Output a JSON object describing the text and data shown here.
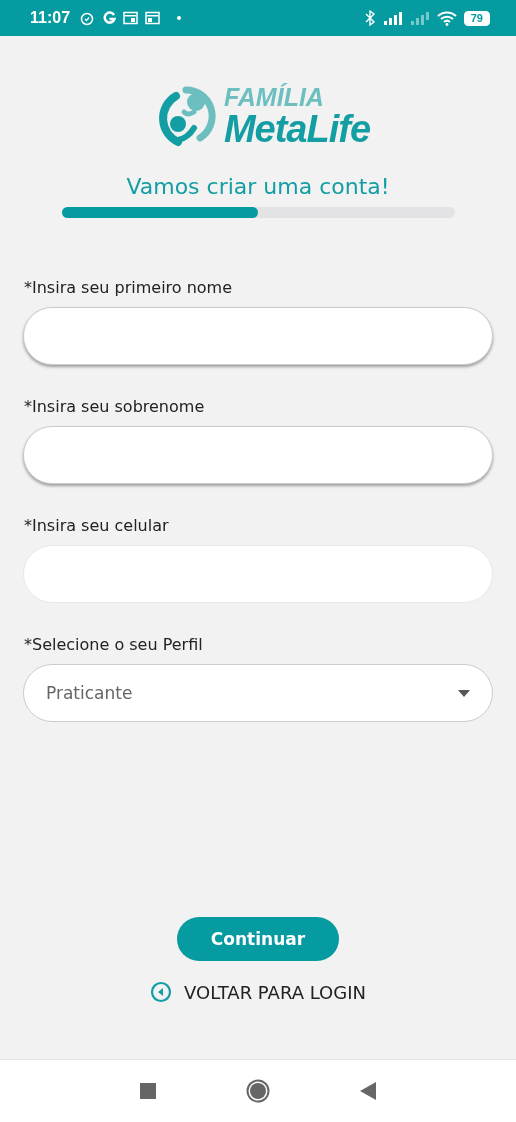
{
  "status_bar": {
    "time": "11:07",
    "battery": "79"
  },
  "logo": {
    "top": "FAMÍLIA",
    "bottom": "MetaLife"
  },
  "title": "Vamos criar uma conta!",
  "progress": {
    "level": 0.5
  },
  "fields": [
    {
      "kind": "text",
      "label": "*Insira seu primeiro nome",
      "raised": true
    },
    {
      "kind": "text",
      "label": "*Insira seu sobrenome",
      "raised": true
    },
    {
      "kind": "text",
      "label": "*Insira seu celular",
      "raised": false
    },
    {
      "kind": "select",
      "label": "*Selecione o seu Perfil",
      "value": "Praticante",
      "raised": false
    }
  ],
  "continue_button": "Continuar",
  "back_link": "VOLTAR PARA LOGIN"
}
